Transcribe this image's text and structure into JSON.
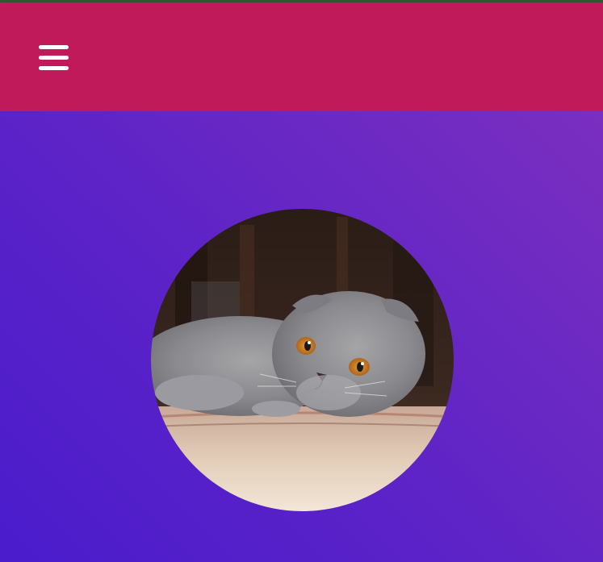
{
  "header": {
    "menu_icon": "hamburger-menu-icon",
    "background_color": "#c01a5a"
  },
  "top_strip": {
    "color": "#2e5a32"
  },
  "hero": {
    "gradient_start": "#4a1ccc",
    "gradient_end": "#7a2fbf",
    "avatar_subject": "grey-cat-photo"
  }
}
